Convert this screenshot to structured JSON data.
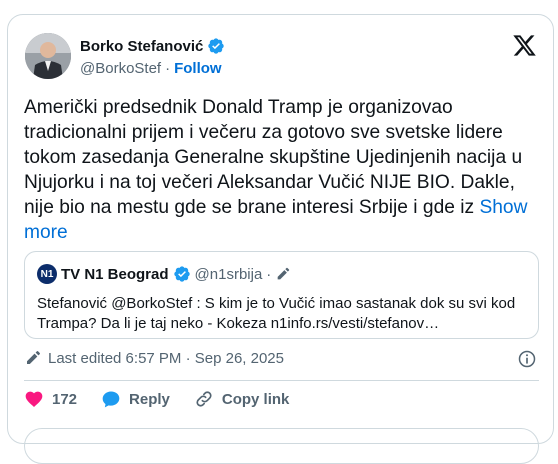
{
  "author": {
    "name": "Borko Stefanović",
    "handle": "@BorkoStef",
    "separator": "·",
    "follow_label": "Follow"
  },
  "tweet": {
    "text": "Američki predsednik Donald Tramp je organizovao tradicionalni prijem i večeru za gotovo sve svetske lidere tokom zasedanja Generalne skupštine Ujedinjenih nacija u Njujorku i na toj večeri Aleksandar Vučić NIJE BIO. Dakle, nije bio na mestu gde se brane interesi Srbije i gde iz",
    "show_more": "Show more"
  },
  "quote": {
    "logo_text": "N1",
    "name": "TV N1 Beograd",
    "handle": "@n1srbija",
    "separator": "·",
    "text": "Stefanović @BorkoStef : S kim je to Vučić imao sastanak dok su svi kod Trampa? Da li je taj neko - Kokeza n1info.rs/vesti/stefanov…"
  },
  "meta": {
    "edited": "Last edited 6:57 PM · Sep 26, 2025"
  },
  "actions": {
    "like_count": "172",
    "reply_label": "Reply",
    "copy_label": "Copy link"
  },
  "colors": {
    "accent": "#006fd6",
    "like": "#f91880",
    "verified": "#1d9bf0",
    "muted": "#536471",
    "border": "#cfd9de"
  }
}
